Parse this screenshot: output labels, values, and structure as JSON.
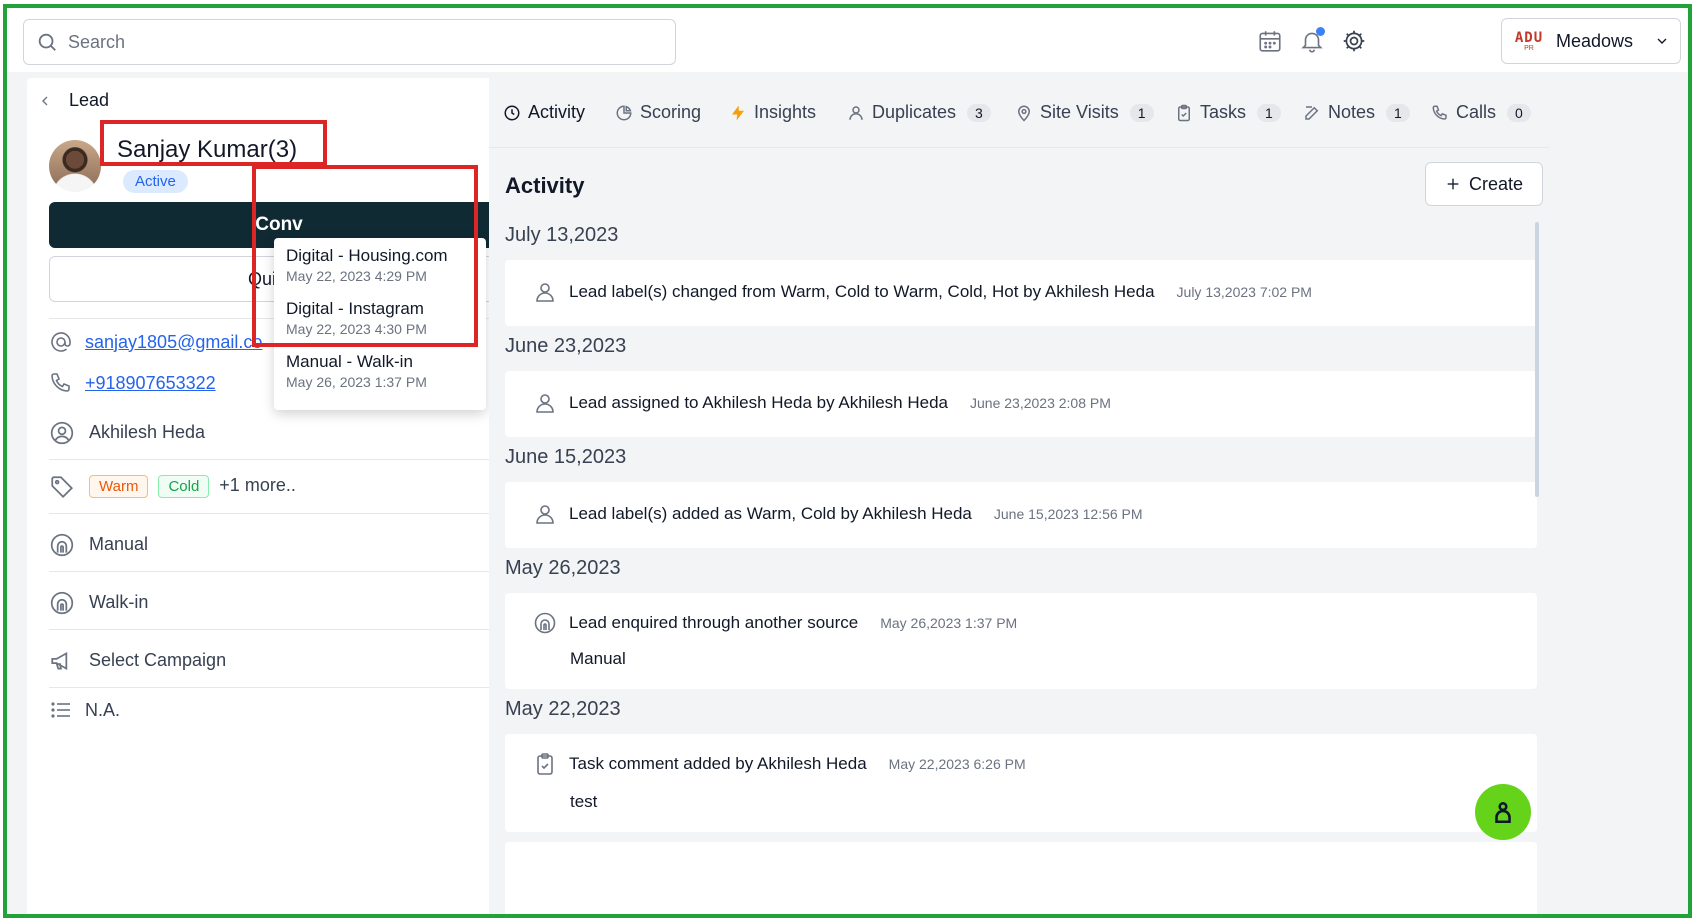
{
  "search": {
    "placeholder": "Search"
  },
  "header": {
    "org_logo_text": "ADU",
    "org_logo_sub": "PR",
    "org_name": "Meadows"
  },
  "lead": {
    "breadcrumb": "Lead",
    "name": "Sanjay  Kumar(3)",
    "status": "Active",
    "convert_label": "Conv",
    "quick_label": "Quick A",
    "email": "sanjay1805@gmail.co",
    "phone": "+918907653322",
    "owner": "Akhilesh Heda",
    "tags": [
      "Warm",
      "Cold"
    ],
    "tags_more": "+1 more..",
    "source": "Manual",
    "sub_source": "Walk-in",
    "campaign": "Select Campaign",
    "notes_placeholder": "N.A."
  },
  "sources_popup": [
    {
      "source": "Digital - Housing.com",
      "date": "May 22, 2023 4:29 PM"
    },
    {
      "source": "Digital - Instagram",
      "date": "May 22, 2023 4:30 PM"
    },
    {
      "source": "Manual - Walk-in",
      "date": "May 26, 2023 1:37 PM"
    }
  ],
  "tabs": [
    {
      "label": "Activity",
      "icon": "clock-icon",
      "count": ""
    },
    {
      "label": "Scoring",
      "icon": "pie-icon",
      "count": ""
    },
    {
      "label": "Insights",
      "icon": "bolt-icon",
      "count": ""
    },
    {
      "label": "Duplicates",
      "icon": "user-icon",
      "count": "3"
    },
    {
      "label": "Site Visits",
      "icon": "location-icon",
      "count": "1"
    },
    {
      "label": "Tasks",
      "icon": "clipboard-icon",
      "count": "1"
    },
    {
      "label": "Notes",
      "icon": "edit-icon",
      "count": "1"
    },
    {
      "label": "Calls",
      "icon": "phone-icon",
      "count": "0"
    }
  ],
  "activity": {
    "title": "Activity",
    "create_label": "Create",
    "groups": [
      {
        "date": "July 13,2023",
        "items": [
          {
            "segments": [
              "Lead label(s) changed from ",
              "Warm, Cold",
              " to ",
              "Warm, Cold, Hot",
              " by ",
              "Akhilesh Heda"
            ],
            "time": "July 13,2023 7:02 PM",
            "sub": ""
          }
        ]
      },
      {
        "date": "June 23,2023",
        "items": [
          {
            "segments": [
              "Lead assigned to ",
              "Akhilesh Heda",
              " by ",
              "Akhilesh Heda"
            ],
            "time": "June 23,2023 2:08 PM",
            "sub": ""
          }
        ]
      },
      {
        "date": "June 15,2023",
        "items": [
          {
            "segments": [
              "Lead label(s) added as ",
              "Warm, Cold",
              " by ",
              "Akhilesh Heda"
            ],
            "time": "June 15,2023 12:56 PM",
            "sub": ""
          }
        ]
      },
      {
        "date": "May 26,2023",
        "items": [
          {
            "segments": [
              "Lead enquired through another source"
            ],
            "time": "May 26,2023 1:37 PM",
            "sub": "Manual"
          }
        ]
      },
      {
        "date": "May 22,2023",
        "items": [
          {
            "segments": [
              "Task comment added by ",
              "Akhilesh Heda"
            ],
            "time": "May 22,2023 6:26 PM",
            "sub": "test"
          }
        ]
      }
    ]
  },
  "colors": {
    "accent": "#102a33",
    "highlight_border": "#dc2626",
    "frame": "#22a33a",
    "fab": "#65d31a",
    "link": "#2563eb"
  }
}
